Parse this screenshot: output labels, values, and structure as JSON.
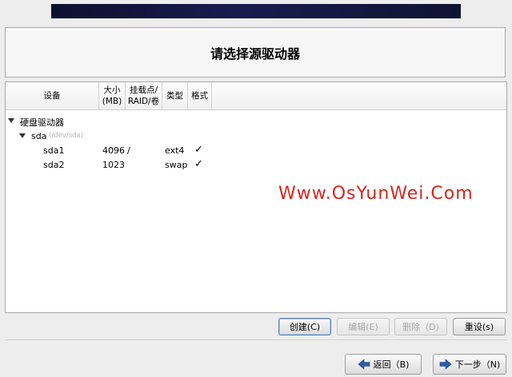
{
  "title": "请选择源驱动器",
  "table": {
    "columns": [
      "设备",
      "大小\n(MB)",
      "挂载点/\nRAID/卷",
      "类型",
      "格式"
    ],
    "group_label": "硬盘驱动器",
    "disk": {
      "name": "sda",
      "path": "(/dev/sda)"
    },
    "partitions": [
      {
        "device": "sda1",
        "size": "4096",
        "mount": "/",
        "type": "ext4",
        "format": "✓"
      },
      {
        "device": "sda2",
        "size": "1023",
        "mount": "",
        "type": "swap",
        "format": "✓"
      }
    ]
  },
  "watermark": "Www.OsYunWei.Com",
  "actions": {
    "create": "创建(C)",
    "edit": "编辑(E)",
    "delete": "删除（D)",
    "reset": "重设(s)"
  },
  "nav": {
    "back": "返回（B)",
    "next": "下一步（N)"
  },
  "colors": {
    "accent_arrow": "#2d5fa8",
    "watermark": "#d7261e",
    "banner": "#171c4e"
  }
}
